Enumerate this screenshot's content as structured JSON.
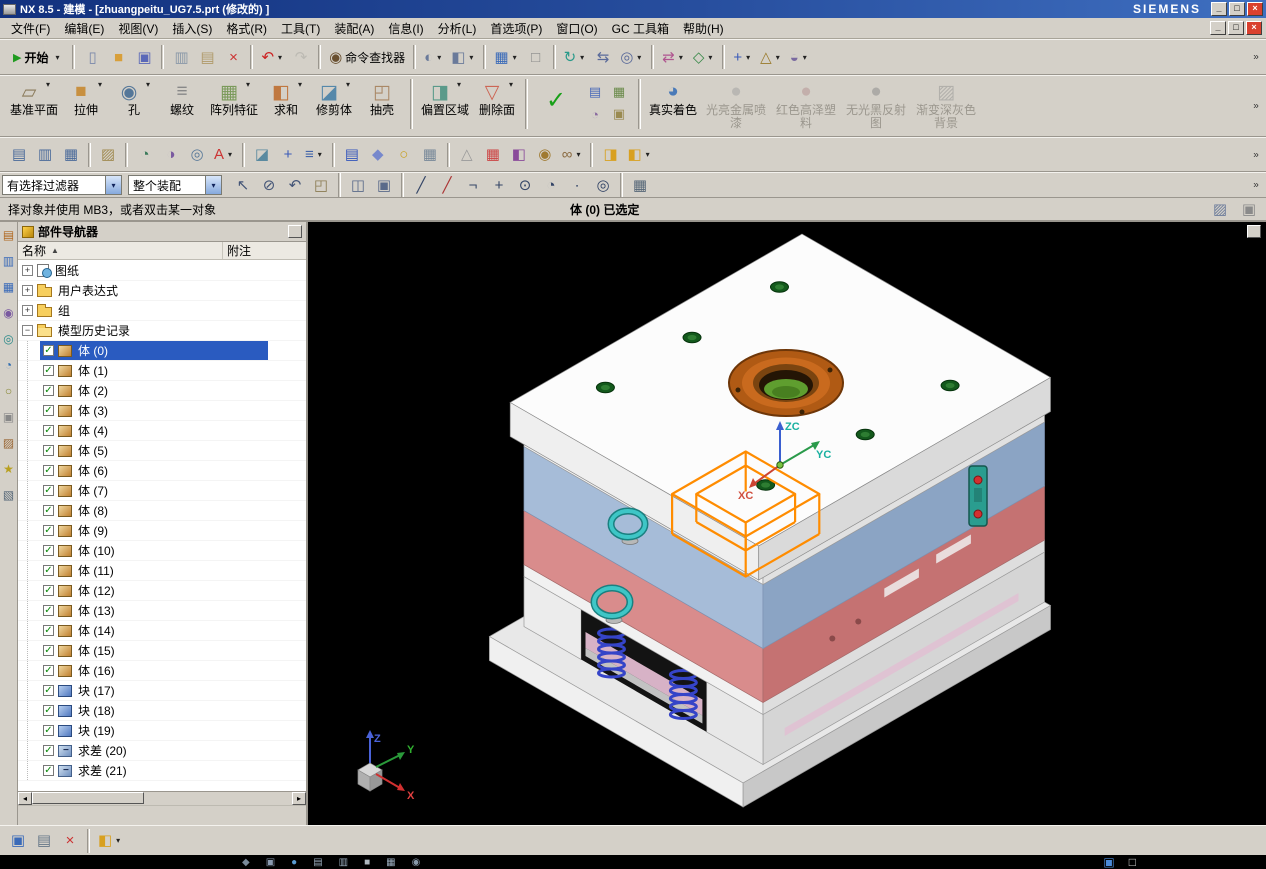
{
  "chrome": {
    "dropdown_glyph": "▾",
    "overflow_glyph": "»",
    "check_glyph": "✓",
    "sort_glyph": "▲",
    "play_glyph": "▶",
    "scroll_left_glyph": "◂",
    "scroll_right_glyph": "▸"
  },
  "titlebar": {
    "title": "NX 8.5 - 建模 - [zhuangpeitu_UG7.5.prt (修改的) ]",
    "brand": "SIEMENS",
    "buttons": [
      {
        "name": "minimize-button",
        "glyph": "_"
      },
      {
        "name": "restore-button",
        "glyph": "□"
      },
      {
        "name": "close-button",
        "glyph": "×",
        "close": true
      }
    ]
  },
  "menubar": {
    "items": [
      "文件(F)",
      "编辑(E)",
      "视图(V)",
      "插入(S)",
      "格式(R)",
      "工具(T)",
      "装配(A)",
      "信息(I)",
      "分析(L)",
      "首选项(P)",
      "窗口(O)",
      "GC 工具箱",
      "帮助(H)"
    ],
    "mdi_buttons": [
      {
        "name": "mdi-minimize-button",
        "glyph": "_"
      },
      {
        "name": "mdi-restore-button",
        "glyph": "□"
      },
      {
        "name": "mdi-close-button",
        "glyph": "×",
        "close": true
      }
    ]
  },
  "toolbar_standard": {
    "start_label": "开始",
    "items": [
      {
        "type": "start"
      },
      {
        "type": "sep"
      },
      {
        "name": "new-file-icon",
        "glyph": "▯",
        "fg": "#7a88aa"
      },
      {
        "name": "open-icon",
        "glyph": "■",
        "fg": "#d89f3a"
      },
      {
        "name": "save-icon",
        "glyph": "▣",
        "fg": "#5a68b8"
      },
      {
        "type": "sep"
      },
      {
        "name": "copy-icon",
        "glyph": "▥",
        "fg": "#8a98a8"
      },
      {
        "name": "paste-icon",
        "glyph": "▤",
        "fg": "#b09a6a"
      },
      {
        "name": "delete-icon",
        "glyph": "×",
        "fg": "#cc3333"
      },
      {
        "type": "sep"
      },
      {
        "name": "undo-icon",
        "glyph": "↶",
        "fg": "#cc2222",
        "dd": true
      },
      {
        "name": "redo-icon",
        "glyph": "↷",
        "fg": "#9a9a94",
        "disabled": true
      },
      {
        "type": "sep"
      },
      {
        "name": "command-finder-icon",
        "glyph": "◉",
        "fg": "#6a5030",
        "label": "命令查找器"
      },
      {
        "type": "sep"
      },
      {
        "name": "shaded-view-icon",
        "glyph": "◐",
        "fg": "#6a7a9a",
        "dd": true
      },
      {
        "name": "view-style-icon",
        "glyph": "◧",
        "fg": "#6a7a9a",
        "dd": true
      },
      {
        "type": "sep"
      },
      {
        "name": "window-layout-icon",
        "glyph": "▦",
        "fg": "#3a6ab8",
        "dd": true
      },
      {
        "name": "new-window-icon",
        "glyph": "□",
        "fg": "#8a8a8a"
      },
      {
        "type": "sep"
      },
      {
        "name": "rotate-view-icon",
        "glyph": "↻",
        "fg": "#2a9a8a",
        "dd": true
      },
      {
        "name": "pan-view-icon",
        "glyph": "⇆",
        "fg": "#5a6a9a"
      },
      {
        "name": "zoom-view-icon",
        "glyph": "◎",
        "fg": "#5a6a9a",
        "dd": true
      },
      {
        "type": "sep"
      },
      {
        "name": "move-component-icon",
        "glyph": "⇄",
        "fg": "#b05590",
        "dd": true
      },
      {
        "name": "assembly-constraints-icon",
        "glyph": "◇",
        "fg": "#3a8a4a",
        "dd": true
      },
      {
        "type": "sep"
      },
      {
        "name": "datum-csys-icon",
        "glyph": "+",
        "fg": "#3a5ab8",
        "dd": true
      },
      {
        "name": "measure-distance-icon",
        "glyph": "△",
        "fg": "#9a7a2a",
        "dd": true
      },
      {
        "name": "material-assign-icon",
        "glyph": "◒",
        "fg": "#7a6aa0",
        "dd": true
      }
    ]
  },
  "toolbar_feature": {
    "items": [
      {
        "name": "datum-plane-button",
        "label": "基准平面",
        "glyph": "▱",
        "fg": "#8a7a5a",
        "dd": true
      },
      {
        "name": "extrude-button",
        "label": "拉伸",
        "glyph": "■",
        "fg": "#c89040",
        "dd": true
      },
      {
        "name": "hole-button",
        "label": "孔",
        "glyph": "◉",
        "fg": "#557799",
        "dd": true
      },
      {
        "name": "thread-button",
        "label": "螺纹",
        "glyph": "≡",
        "fg": "#888888"
      },
      {
        "name": "pattern-feature-button",
        "label": "阵列特征",
        "glyph": "▦",
        "fg": "#7a9a5a",
        "dd": true
      },
      {
        "name": "unite-button",
        "label": "求和",
        "glyph": "◧",
        "fg": "#c07840",
        "dd": true
      },
      {
        "name": "trim-body-button",
        "label": "修剪体",
        "glyph": "◪",
        "fg": "#5588aa",
        "dd": true
      },
      {
        "name": "shell-button",
        "label": "抽壳",
        "glyph": "◰",
        "fg": "#aa8866"
      },
      {
        "type": "sep"
      },
      {
        "name": "offset-region-button",
        "label": "偏置区域",
        "glyph": "◨",
        "fg": "#5a9a8a",
        "dd": true
      },
      {
        "name": "delete-face-button",
        "label": "删除面",
        "glyph": "▽",
        "fg": "#cc6655",
        "dd": true
      },
      {
        "type": "sep"
      },
      {
        "name": "examine-geometry-button",
        "glyph": "✓",
        "fg": "#18a018",
        "tall": true
      },
      {
        "type": "minigrid",
        "icons": [
          {
            "name": "display-table-icon",
            "glyph": "▤",
            "fg": "#4a6ab8"
          },
          {
            "name": "sheet-view-icon",
            "glyph": "▦",
            "fg": "#6a8a4a"
          },
          {
            "name": "curve-tools-icon",
            "glyph": "◔",
            "fg": "#8a6aa0"
          },
          {
            "name": "scan-tools-icon",
            "glyph": "▣",
            "fg": "#9a8a50"
          }
        ]
      },
      {
        "type": "sep"
      },
      {
        "name": "true-shading-button",
        "label": "真实着色",
        "glyph": "◕",
        "fg": "#4a7ab8"
      },
      {
        "name": "shiny-metal-button",
        "label": "光亮金属喷漆",
        "glyph": "●",
        "fg": "#9a9a9a",
        "disabled": true
      },
      {
        "name": "red-gloss-plastic-button",
        "label": "红色高泽塑料",
        "glyph": "●",
        "fg": "#b08888",
        "disabled": true
      },
      {
        "name": "matte-black-reflect-button",
        "label": "无光黑反射图",
        "glyph": "●",
        "fg": "#808080",
        "disabled": true
      },
      {
        "name": "gray-gradient-background-button",
        "label": "渐变深灰色背景",
        "glyph": "▨",
        "fg": "#8a8a8a",
        "disabled": true
      }
    ]
  },
  "toolbar_utility": {
    "items": [
      {
        "name": "layer-settings-icon",
        "glyph": "▤",
        "fg": "#4a6a9a"
      },
      {
        "name": "visible-in-view-icon",
        "glyph": "▥",
        "fg": "#4a6a9a"
      },
      {
        "name": "layer-category-icon",
        "glyph": "▦",
        "fg": "#4a6a9a"
      },
      {
        "type": "sep"
      },
      {
        "name": "information-window-icon",
        "glyph": "▨",
        "fg": "#a08a50"
      },
      {
        "type": "sep"
      },
      {
        "name": "expressions-icon",
        "glyph": "◔",
        "fg": "#3a7a5a"
      },
      {
        "name": "object-display-icon",
        "glyph": "◑",
        "fg": "#7a5aa0"
      },
      {
        "name": "show-hide-icon",
        "glyph": "◎",
        "fg": "#5a7a9a"
      },
      {
        "name": "annotation-icon",
        "glyph": "A",
        "fg": "#cc3333",
        "dd": true
      },
      {
        "type": "sep"
      },
      {
        "name": "edit-section-icon",
        "glyph": "◪",
        "fg": "#5a8aa0"
      },
      {
        "name": "wcs-dynamics-icon",
        "glyph": "+",
        "fg": "#3a5ab8"
      },
      {
        "name": "command-list-icon",
        "glyph": "≡",
        "fg": "#4466aa",
        "dd": true
      },
      {
        "type": "sep"
      },
      {
        "name": "journal-icon",
        "glyph": "▤",
        "fg": "#3355bb"
      },
      {
        "name": "macro-icon",
        "glyph": "◆",
        "fg": "#7788cc"
      },
      {
        "name": "helix-icon",
        "glyph": "○",
        "fg": "#c8a020"
      },
      {
        "name": "lattice-icon",
        "glyph": "▦",
        "fg": "#778899"
      },
      {
        "type": "sep"
      },
      {
        "name": "draft-analysis-icon",
        "glyph": "△",
        "fg": "#9a9a9a"
      },
      {
        "name": "part-families-icon",
        "glyph": "▦",
        "fg": "#cc4444"
      },
      {
        "name": "mold-tools-icon",
        "glyph": "◧",
        "fg": "#8a4a9a"
      },
      {
        "name": "gear-modeling-icon",
        "glyph": "◉",
        "fg": "#a07a30"
      },
      {
        "name": "bearing-tools-icon",
        "glyph": "∞",
        "fg": "#8a6a40",
        "dd": true
      },
      {
        "type": "sep"
      },
      {
        "name": "reuse-block-icon",
        "glyph": "◨",
        "fg": "#d8a020"
      },
      {
        "name": "udf-library-icon",
        "glyph": "◧",
        "fg": "#d8a020",
        "dd": true
      }
    ]
  },
  "selection_bar": {
    "filter_value": "有选择过滤器",
    "scope_value": "整个装配",
    "icons": [
      {
        "name": "select-scope-icon",
        "glyph": "↖",
        "fg": "#445577"
      },
      {
        "name": "deselect-all-icon",
        "glyph": "⊘",
        "fg": "#445577"
      },
      {
        "name": "select-previous-icon",
        "glyph": "↶",
        "fg": "#445577"
      },
      {
        "name": "capture-region-icon",
        "glyph": "◰",
        "fg": "#8a7a50"
      },
      {
        "type": "sep"
      },
      {
        "name": "top-assembly-icon",
        "glyph": "◫",
        "fg": "#5a6a8a"
      },
      {
        "name": "component-select-icon",
        "glyph": "▣",
        "fg": "#5a6a8a"
      },
      {
        "type": "sep"
      },
      {
        "name": "endpoint-snap-icon",
        "glyph": "╱",
        "fg": "#334466"
      },
      {
        "name": "midpoint-snap-icon",
        "glyph": "╱",
        "fg": "#aa3333"
      },
      {
        "name": "corner-snap-icon",
        "glyph": "¬",
        "fg": "#334466"
      },
      {
        "name": "intersection-snap-icon",
        "glyph": "+",
        "fg": "#334466"
      },
      {
        "name": "arc-center-snap-icon",
        "glyph": "⊙",
        "fg": "#334466"
      },
      {
        "name": "quadrant-snap-icon",
        "glyph": "◔",
        "fg": "#334466"
      },
      {
        "name": "point-snap-icon",
        "glyph": "∙",
        "fg": "#334466"
      },
      {
        "name": "more-snaps-icon",
        "glyph": "◎",
        "fg": "#334466"
      },
      {
        "type": "sep"
      },
      {
        "name": "snapshot-grid-icon",
        "glyph": "▦",
        "fg": "#556677"
      }
    ]
  },
  "prompt_bar": {
    "message": "择对象并使用 MB3，或者双击某一对象",
    "status": "体 (0) 已选定",
    "buttons": [
      {
        "name": "prompt-stack-icon",
        "glyph": "▨",
        "fg": "#6a7a9a"
      },
      {
        "name": "prompt-fit-icon",
        "glyph": "▣",
        "fg": "#8a8a8a"
      }
    ]
  },
  "resource_bar": {
    "items": [
      {
        "name": "assembly-navigator-icon",
        "glyph": "▤",
        "fg": "#b06820"
      },
      {
        "name": "constraint-navigator-icon",
        "glyph": "▥",
        "fg": "#3a6ab8"
      },
      {
        "name": "part-navigator-icon",
        "glyph": "▦",
        "fg": "#3a6ab8"
      },
      {
        "name": "reuse-library-icon",
        "glyph": "◉",
        "fg": "#7a5aa0"
      },
      {
        "name": "hd3d-tools-icon",
        "glyph": "◎",
        "fg": "#2a8a8a"
      },
      {
        "name": "web-browser-icon",
        "glyph": "◔",
        "fg": "#2a6ab0"
      },
      {
        "name": "history-icon",
        "glyph": "○",
        "fg": "#888833"
      },
      {
        "name": "process-studio-icon",
        "glyph": "▣",
        "fg": "#888888"
      },
      {
        "name": "manufacturing-wizard-icon",
        "glyph": "▨",
        "fg": "#996633"
      },
      {
        "name": "roles-icon",
        "glyph": "★",
        "fg": "#b8a020"
      },
      {
        "name": "system-scenes-icon",
        "glyph": "▧",
        "fg": "#556677"
      }
    ]
  },
  "navigator": {
    "title": "部件导航器",
    "columns": [
      "名称",
      "附注"
    ],
    "tree": [
      {
        "kind": "group",
        "expand": "plus",
        "icon": "drawing",
        "label": "图纸"
      },
      {
        "kind": "group",
        "expand": "plus",
        "icon": "folder",
        "label": "用户表达式"
      },
      {
        "kind": "group",
        "expand": "plus",
        "icon": "folder",
        "label": "组"
      },
      {
        "kind": "group",
        "expand": "minus",
        "icon": "folder-open",
        "label": "模型历史记录"
      },
      {
        "kind": "body",
        "label": "体 (0)",
        "selected": true
      },
      {
        "kind": "body",
        "label": "体 (1)"
      },
      {
        "kind": "body",
        "label": "体 (2)"
      },
      {
        "kind": "body",
        "label": "体 (3)"
      },
      {
        "kind": "body",
        "label": "体 (4)"
      },
      {
        "kind": "body",
        "label": "体 (5)"
      },
      {
        "kind": "body",
        "label": "体 (6)"
      },
      {
        "kind": "body",
        "label": "体 (7)"
      },
      {
        "kind": "body",
        "label": "体 (8)"
      },
      {
        "kind": "body",
        "label": "体 (9)"
      },
      {
        "kind": "body",
        "label": "体 (10)"
      },
      {
        "kind": "body",
        "label": "体 (11)"
      },
      {
        "kind": "body",
        "label": "体 (12)"
      },
      {
        "kind": "body",
        "label": "体 (13)"
      },
      {
        "kind": "body",
        "label": "体 (14)"
      },
      {
        "kind": "body",
        "label": "体 (15)"
      },
      {
        "kind": "body",
        "label": "体 (16)"
      },
      {
        "kind": "block",
        "label": "块 (17)"
      },
      {
        "kind": "block",
        "label": "块 (18)"
      },
      {
        "kind": "block",
        "label": "块 (19)"
      },
      {
        "kind": "bool",
        "label": "求差 (20)"
      },
      {
        "kind": "bool",
        "label": "求差 (21)"
      }
    ]
  },
  "viewport": {
    "background": "#000000",
    "selection_color": "#ff8c00",
    "triad": {
      "z": "ZC",
      "y": "YC",
      "x": "XC"
    },
    "wcs": {
      "x": "X",
      "y": "Y",
      "z": "Z"
    }
  },
  "bottom_toolbar": {
    "items": [
      {
        "name": "view-tools-icon",
        "glyph": "▣",
        "fg": "#3a6ab8"
      },
      {
        "name": "snap-view-icon",
        "glyph": "▤",
        "fg": "#667788"
      },
      {
        "name": "cancel-filter-icon",
        "glyph": "×",
        "fg": "#cc3333"
      },
      {
        "type": "sep"
      },
      {
        "name": "user-tools-icon",
        "glyph": "◧",
        "fg": "#d8a020",
        "dd": true
      }
    ]
  },
  "taskbar": {
    "items": [
      {
        "name": "taskbar-icon-1",
        "glyph": "◆",
        "fg": "#7a8a9a"
      },
      {
        "name": "taskbar-icon-2",
        "glyph": "▣",
        "fg": "#8a9ab0"
      },
      {
        "name": "taskbar-icon-3",
        "glyph": "●",
        "fg": "#5a9ad0"
      },
      {
        "name": "taskbar-icon-4",
        "glyph": "▤",
        "fg": "#99aabb"
      },
      {
        "name": "taskbar-icon-5",
        "glyph": "▥",
        "fg": "#99aabb"
      },
      {
        "name": "taskbar-icon-6",
        "glyph": "■",
        "fg": "#b0b8c0"
      },
      {
        "name": "taskbar-icon-7",
        "glyph": "▦",
        "fg": "#99aabb"
      },
      {
        "name": "taskbar-icon-8",
        "glyph": "◉",
        "fg": "#8899aa"
      }
    ],
    "tray": [
      {
        "name": "tray-network-icon",
        "glyph": "▣",
        "fg": "#4a8ad8"
      },
      {
        "name": "tray-volume-icon",
        "glyph": "□",
        "fg": "#cfcfcf"
      }
    ]
  }
}
